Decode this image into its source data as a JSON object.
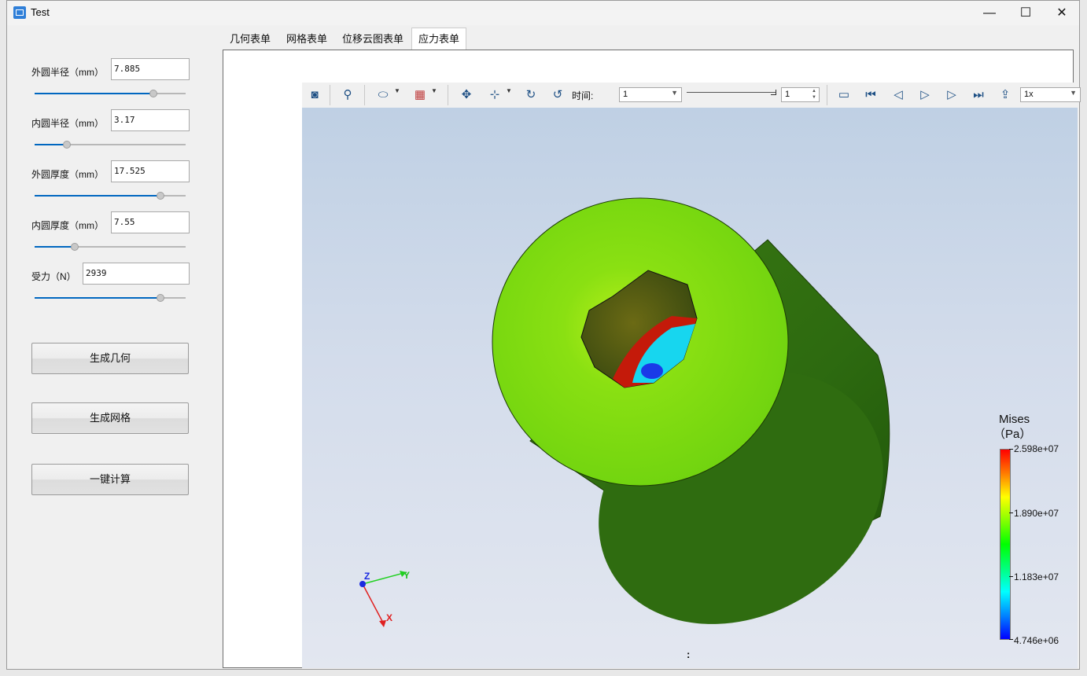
{
  "window": {
    "title": "Test",
    "minimize": "—",
    "maximize": "☐",
    "close": "✕"
  },
  "params": [
    {
      "label": "外圆半径（mm）",
      "value": "7.885",
      "slider": 0.8
    },
    {
      "label": "内圆半径（mm）",
      "value": "3.17",
      "slider": 0.2
    },
    {
      "label": "外圆厚度（mm）",
      "value": "17.525",
      "slider": 0.85
    },
    {
      "label": "内圆厚度（mm）",
      "value": "7.55",
      "slider": 0.25
    },
    {
      "label": "受力（N）",
      "value": "2939",
      "slider": 0.85
    }
  ],
  "buttons": {
    "gen_geometry": "生成几何",
    "gen_mesh": "生成网格",
    "compute": "一键计算"
  },
  "tabs": [
    "几何表单",
    "网格表单",
    "位移云图表单",
    "应力表单"
  ],
  "active_tab": 3,
  "toolbar": {
    "time_label": "时间:",
    "time_value": "1",
    "step_value": "1",
    "speed_value": "1x",
    "icons": [
      "camera-icon",
      "zoom-icon",
      "clip-icon",
      "cube-color-icon",
      "fit-icon",
      "axes-icon",
      "rotate-cw-icon",
      "rotate-ccw-icon",
      "record-icon",
      "first-frame-icon",
      "prev-frame-icon",
      "play-icon",
      "next-frame-icon",
      "last-frame-icon",
      "export-icon"
    ]
  },
  "legend": {
    "title_line1": "Mises",
    "title_line2": "（Pa）",
    "max": "2.598e+07",
    "mid_high": "1.890e+07",
    "mid_low": "1.183e+07",
    "min": "4.746e+06",
    "colors": [
      "#0000ff",
      "#00ffff",
      "#00ff00",
      "#ffff00",
      "#ff0000"
    ]
  },
  "axes": {
    "x": "X",
    "y": "Y",
    "z": "Z"
  },
  "status_mark": ":"
}
